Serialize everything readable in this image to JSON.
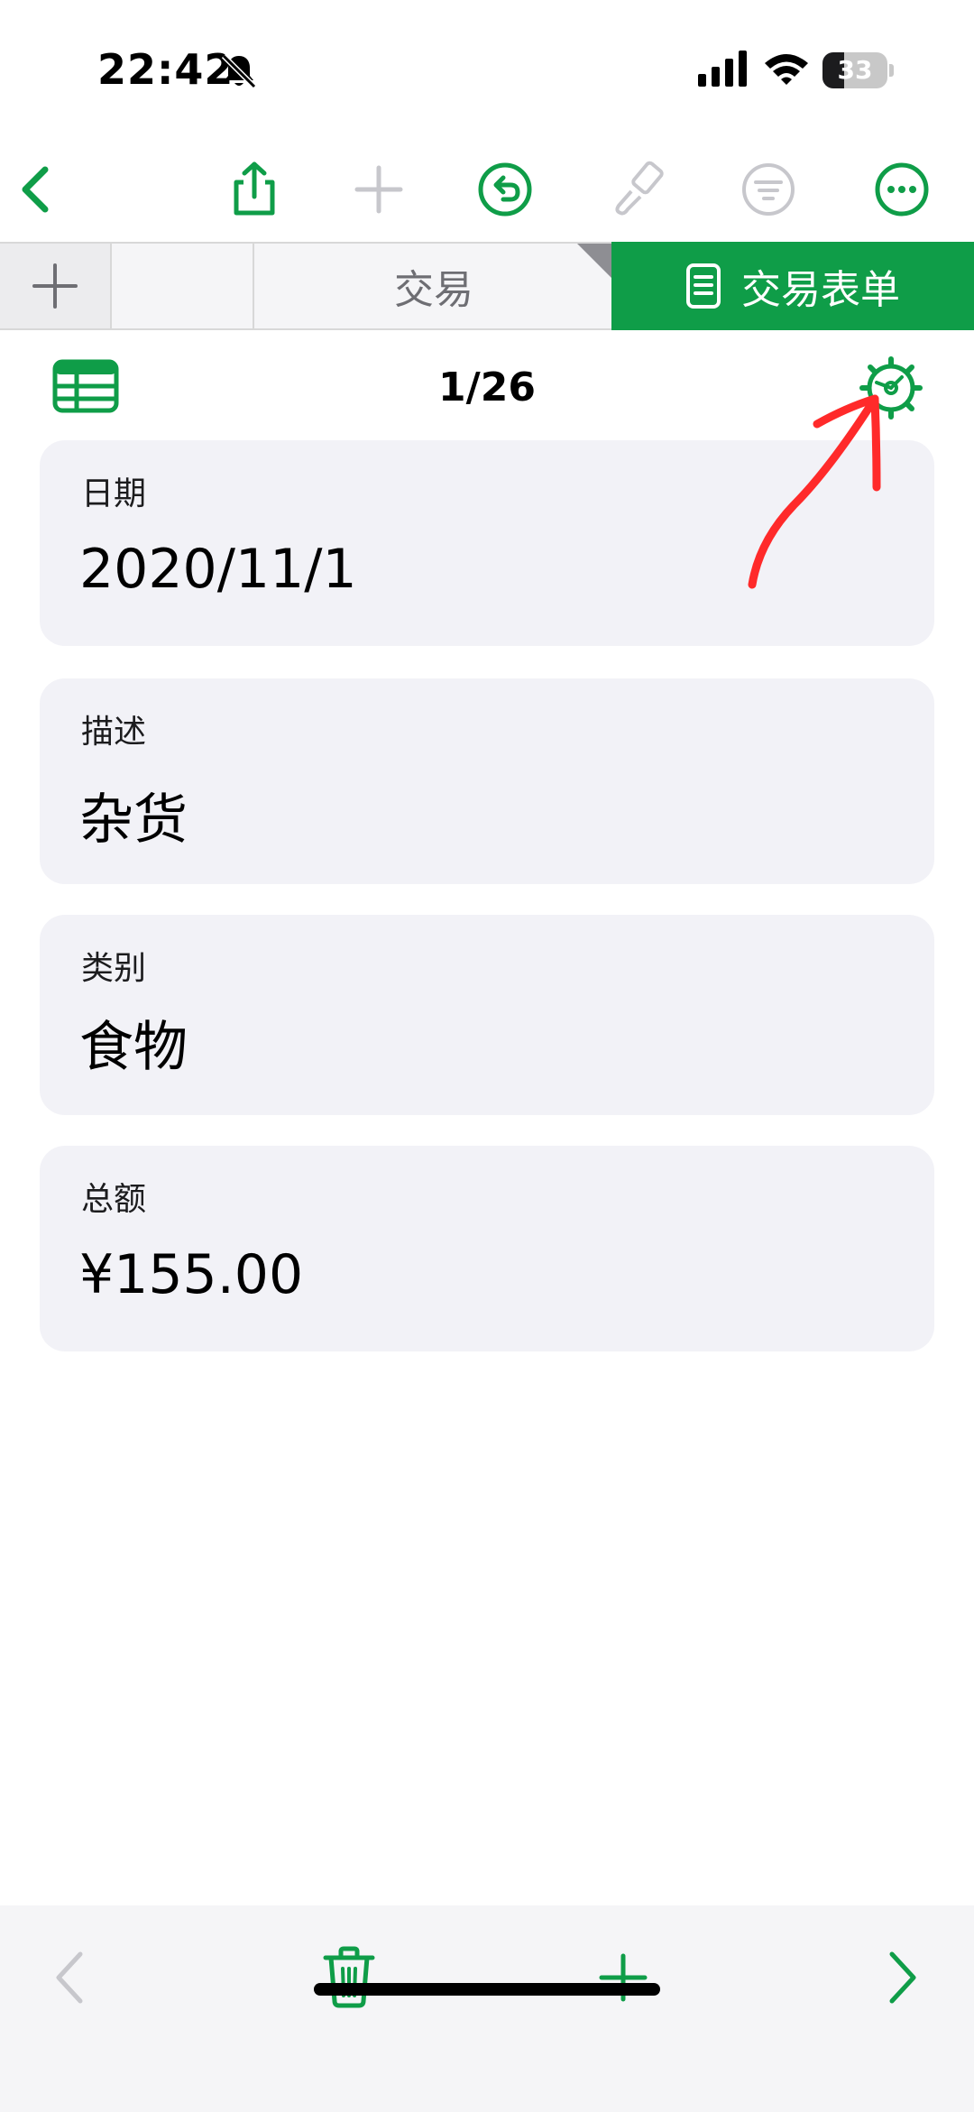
{
  "status_bar": {
    "time": "22:42",
    "battery_level": "33",
    "battery_fraction": 0.33,
    "icons": [
      "bell-slash-icon",
      "signal-icon",
      "wifi-icon",
      "battery-icon"
    ]
  },
  "toolbar": {
    "icons": [
      "back-chevron-icon",
      "share-icon",
      "add-icon",
      "undo-icon",
      "format-brush-icon",
      "filter-icon",
      "more-icon"
    ]
  },
  "tabs": {
    "items": [
      "交易",
      "交易表单"
    ],
    "active": "交易表单"
  },
  "form": {
    "counter": "1/26",
    "fields": [
      {
        "label": "日期",
        "value": "2020/11/1"
      },
      {
        "label": "描述",
        "value": "杂货"
      },
      {
        "label": "类别",
        "value": "食物"
      },
      {
        "label": "总额",
        "value": "¥155.00"
      }
    ]
  },
  "bottom_bar": {
    "icons": [
      "previous-chevron-icon",
      "trash-icon",
      "add-record-icon",
      "next-chevron-icon"
    ]
  },
  "colors": {
    "accent": "#0f9d48",
    "card_background": "#f2f2f7",
    "disabled": "#c7c7cc",
    "annotation": "#ff2a2a"
  }
}
